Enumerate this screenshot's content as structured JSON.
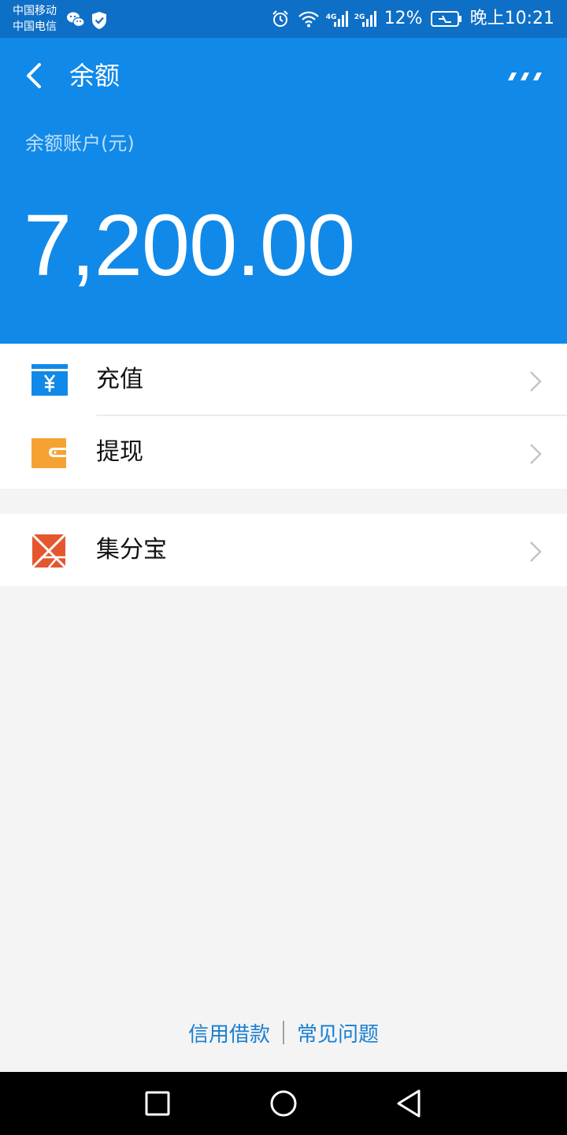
{
  "status_bar": {
    "carrier_1": "中国移动",
    "carrier_2": "中国电信",
    "network_1": "4G",
    "network_2": "2G",
    "battery": "12%",
    "time": "晚上10:21"
  },
  "header": {
    "title": "余额",
    "account_label": "余额账户(元)",
    "balance": "7,200.00"
  },
  "menu": {
    "items": [
      {
        "label": "充值",
        "icon": "recharge-yuan-icon"
      },
      {
        "label": "提现",
        "icon": "wallet-icon"
      },
      {
        "label": "集分宝",
        "icon": "jifenbao-icon"
      }
    ]
  },
  "footer": {
    "link_1": "信用借款",
    "link_2": "常见问题"
  },
  "colors": {
    "status_bar": "#0e6fc7",
    "header": "#1189e8",
    "recharge_icon": "#1189e8",
    "withdraw_icon": "#f5a233",
    "jifenbao_icon": "#e4572e",
    "link": "#1a7fd0"
  }
}
